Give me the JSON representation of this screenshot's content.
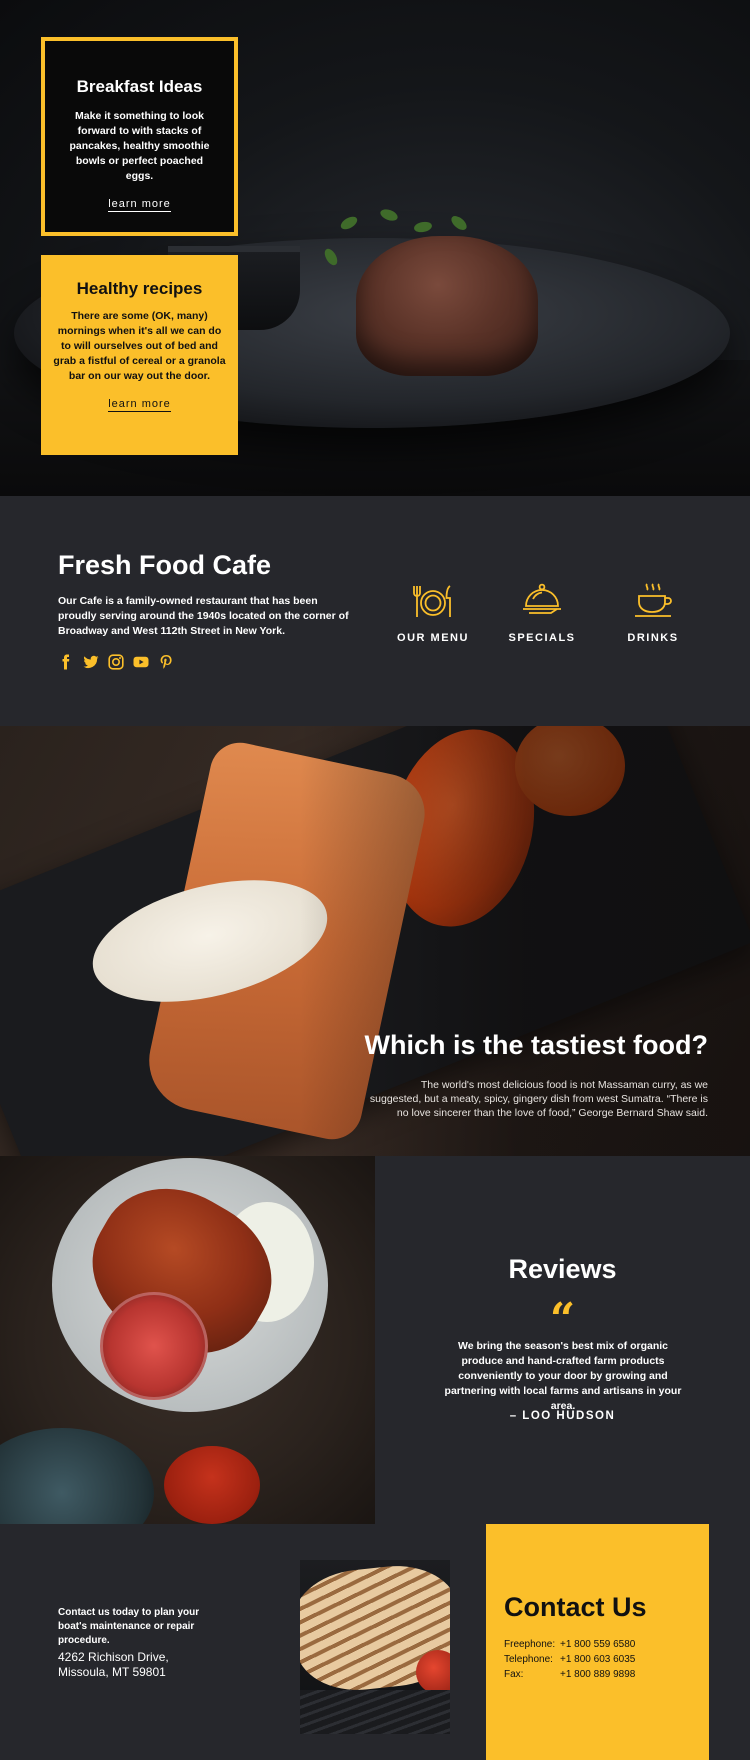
{
  "hero": {
    "breakfast": {
      "title": "Breakfast Ideas",
      "text": "Make it something to look forward to with stacks of pancakes, healthy smoothie bowls or perfect poached eggs.",
      "link": "learn more"
    },
    "healthy": {
      "title": "Healthy recipes",
      "text": "There are some (OK, many) mornings when it's all we can do to will ourselves out of bed and grab a fistful of cereal or a granola bar on our way out the door.",
      "link": "learn more"
    }
  },
  "about": {
    "title": "Fresh Food Cafe",
    "description": "Our Cafe is a family-owned restaurant that has been proudly serving around the 1940s located on the corner of Broadway and West 112th Street in New York.",
    "social_icons": [
      "facebook-icon",
      "twitter-icon",
      "instagram-icon",
      "youtube-icon",
      "pinterest-icon"
    ],
    "services": [
      {
        "label": "OUR MENU",
        "icon": "plate-cutlery-icon"
      },
      {
        "label": "SPECIALS",
        "icon": "cloche-icon"
      },
      {
        "label": "DRINKS",
        "icon": "coffee-cup-icon"
      }
    ]
  },
  "tastiest": {
    "title": "Which is the tastiest food?",
    "quote": "The world's most delicious food is not Massaman curry, as we suggested, but a meaty, spicy, gingery dish from west Sumatra. “There is no love sincerer than the love of food,” George Bernard Shaw said."
  },
  "reviews": {
    "title": "Reviews",
    "quote_mark": "“",
    "text": "We bring the season's best mix of organic produce and hand-crafted farm products conveniently to your door by growing and partnering with local farms and artisans in your area.",
    "author": "– LOO HUDSON"
  },
  "contact": {
    "lead": "Contact us today to plan your boat's maintenance or repair procedure.",
    "address_line1": "4262 Richison Drive,",
    "address_line2": "Missoula, MT 59801",
    "title": "Contact Us",
    "rows": [
      {
        "key": "Freephone:",
        "value": "+1 800 559 6580"
      },
      {
        "key": "Telephone:",
        "value": "+1 800 603 6035"
      },
      {
        "key": "Fax:",
        "value": "+1 800 889 9898"
      }
    ]
  },
  "colors": {
    "accent": "#fbbf2a",
    "dark_bg": "#26272c",
    "card_black": "#090909"
  }
}
